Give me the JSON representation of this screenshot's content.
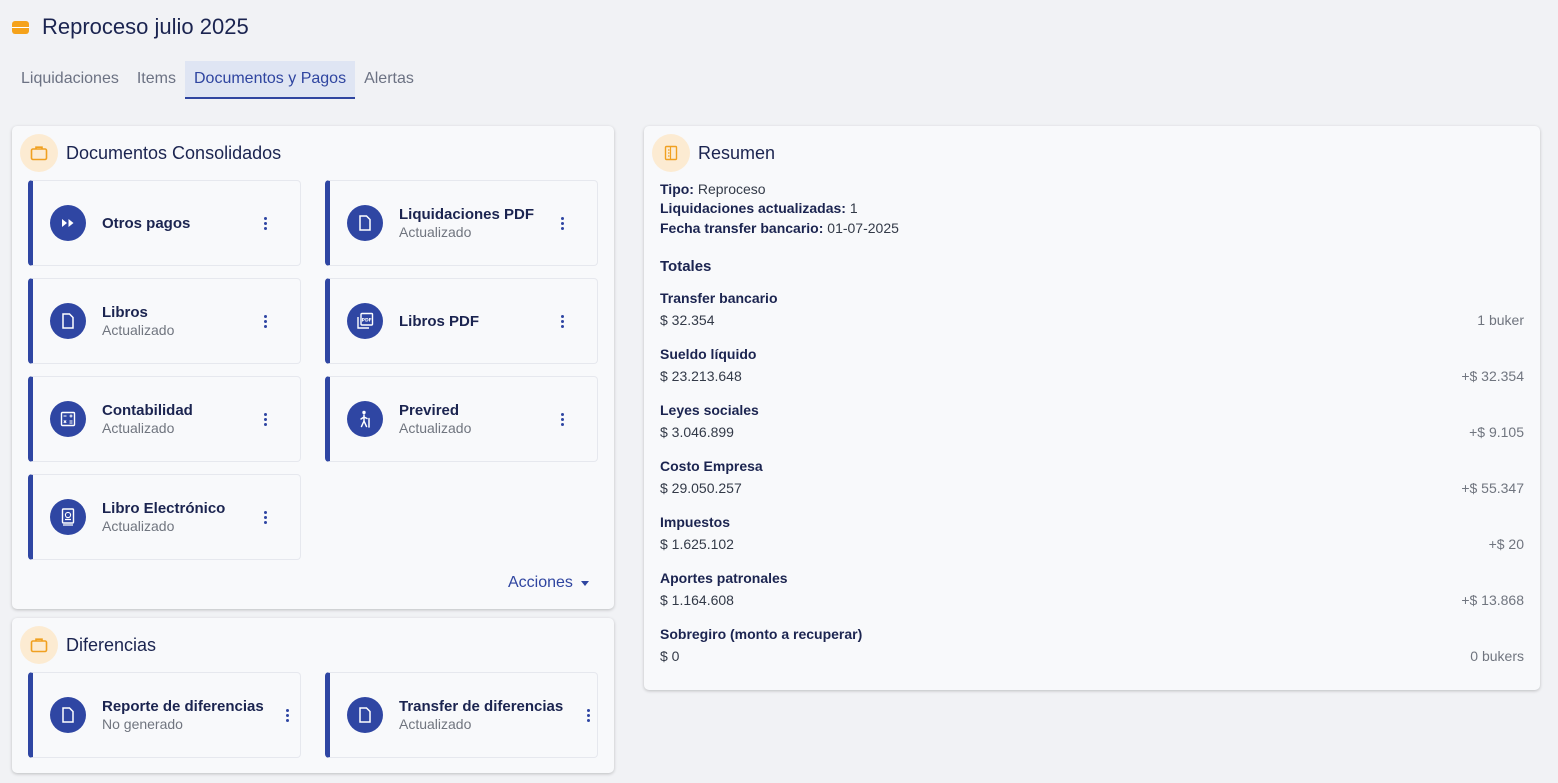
{
  "header": {
    "title": "Reproceso julio 2025"
  },
  "tabs": [
    {
      "label": "Liquidaciones"
    },
    {
      "label": "Items"
    },
    {
      "label": "Documentos y Pagos"
    },
    {
      "label": "Alertas"
    }
  ],
  "active_tab": "Documentos y Pagos",
  "consolidados": {
    "title": "Documentos Consolidados",
    "tiles": [
      {
        "title": "Otros pagos",
        "subtitle": "",
        "icon": "fast-forward-icon"
      },
      {
        "title": "Liquidaciones PDF",
        "subtitle": "Actualizado",
        "icon": "document-icon"
      },
      {
        "title": "Libros",
        "subtitle": "Actualizado",
        "icon": "document-icon"
      },
      {
        "title": "Libros PDF",
        "subtitle": "",
        "icon": "pdf-stack-icon"
      },
      {
        "title": "Contabilidad",
        "subtitle": "Actualizado",
        "icon": "calculator-icon"
      },
      {
        "title": "Previred",
        "subtitle": "Actualizado",
        "icon": "walker-icon"
      },
      {
        "title": "Libro Electrónico",
        "subtitle": "Actualizado",
        "icon": "passport-book-icon"
      }
    ],
    "actions_label": "Acciones"
  },
  "diferencias": {
    "title": "Diferencias",
    "tiles": [
      {
        "title": "Reporte de diferencias",
        "subtitle": "No generado",
        "icon": "document-icon"
      },
      {
        "title": "Transfer de diferencias",
        "subtitle": "Actualizado",
        "icon": "document-icon"
      }
    ]
  },
  "resumen": {
    "title": "Resumen",
    "tipo_label": "Tipo:",
    "tipo_value": "Reproceso",
    "liq_label": "Liquidaciones actualizadas:",
    "liq_value": "1",
    "fecha_label": "Fecha transfer bancario:",
    "fecha_value": "01-07-2025",
    "totales_title": "Totales",
    "totals": [
      {
        "label": "Transfer bancario",
        "value": "$ 32.354",
        "delta": "1 buker"
      },
      {
        "label": "Sueldo líquido",
        "value": "$ 23.213.648",
        "delta": "+$ 32.354"
      },
      {
        "label": "Leyes sociales",
        "value": "$ 3.046.899",
        "delta": "+$ 9.105"
      },
      {
        "label": "Costo Empresa",
        "value": "$ 29.050.257",
        "delta": "+$ 55.347"
      },
      {
        "label": "Impuestos",
        "value": "$ 1.625.102",
        "delta": "+$ 20"
      },
      {
        "label": "Aportes patronales",
        "value": "$ 1.164.608",
        "delta": "+$ 13.868"
      },
      {
        "label": "Sobregiro (monto a recuperar)",
        "value": "$ 0",
        "delta": "0 bukers"
      }
    ]
  },
  "colors": {
    "accent": "#2f46a3",
    "brand_orange": "#f5a21b",
    "background": "#f1f2f5"
  }
}
